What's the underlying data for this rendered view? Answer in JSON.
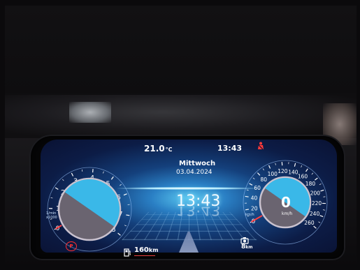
{
  "status_bar": {
    "outside_temp": "21.0",
    "temp_unit": "°C",
    "clock": "13:43"
  },
  "center": {
    "weekday": "Mittwoch",
    "date": "03.04.2024",
    "time": "13:43"
  },
  "tachometer": {
    "ticks": [
      "1",
      "2",
      "3",
      "4",
      "5",
      "6",
      "7",
      "8"
    ],
    "zero_label": "0",
    "unit_label_line1": "1/min",
    "unit_label_line2": "x1000",
    "value_rpm_thousands": 0
  },
  "speedometer": {
    "ticks": [
      "20",
      "40",
      "60",
      "80",
      "100",
      "120",
      "140",
      "160",
      "180",
      "200",
      "220",
      "240",
      "260"
    ],
    "zero_label": "0",
    "speed_value": "0",
    "speed_unit": "km/h",
    "small_unit": "km/h"
  },
  "bottom_bar": {
    "range_value": "160",
    "range_unit": "km",
    "trip_value": "8",
    "trip_unit": "km"
  },
  "warning_lights": {
    "seatbelt": "seatbelt-warning-icon",
    "parking_brake_label": "P"
  },
  "colors": {
    "gauge_fill": "#3ab8e8",
    "needle": "#ff4040",
    "warning": "#ff3030",
    "screen_glow": "#5ac8f0"
  }
}
